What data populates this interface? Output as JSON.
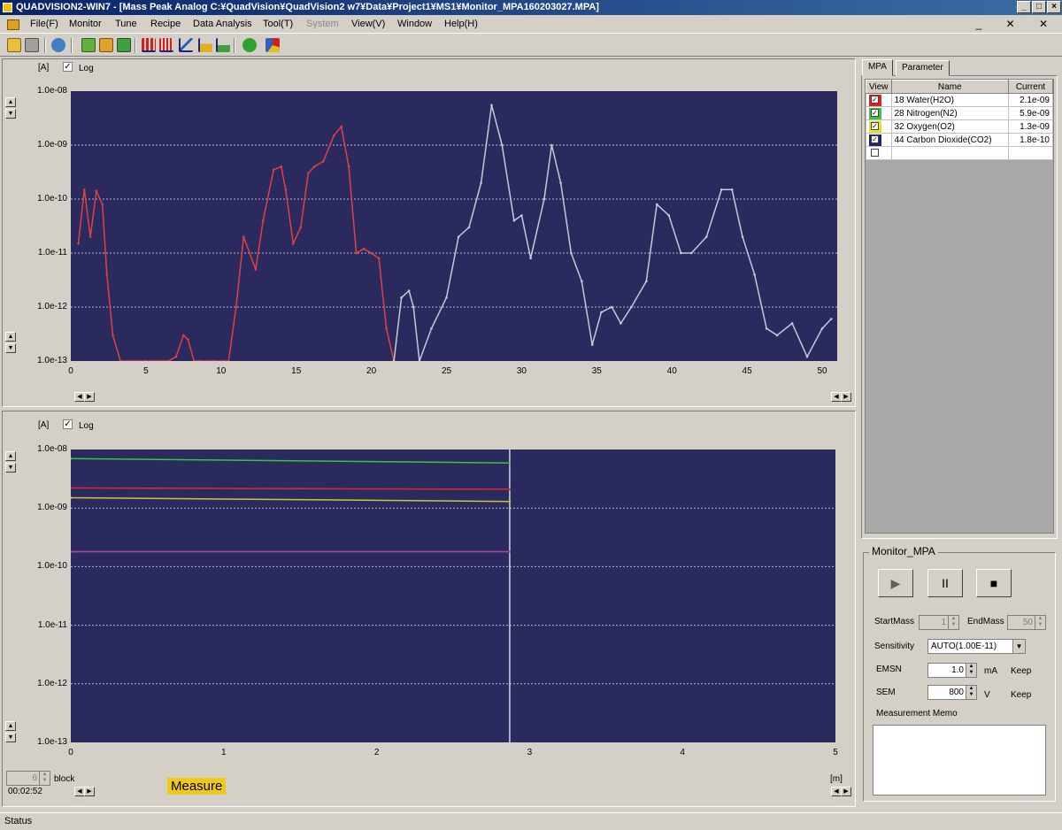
{
  "window": {
    "title": "QUADVISION2-WIN7 - [Mass Peak Analog C:¥QuadVision¥QuadVision2 w7¥Data¥Project1¥MS1¥Monitor_MPA160203027.MPA]",
    "min_btn": "_",
    "max_btn": "□",
    "close_btn": "×"
  },
  "menu": [
    "File(F)",
    "Monitor",
    "Tune",
    "Recipe",
    "Data Analysis",
    "Tool(T)",
    "System",
    "View(V)",
    "Window",
    "Help(H)"
  ],
  "mdi_controls": "_ ✕ ✕",
  "top_plot": {
    "unit_label": "[A]",
    "log_label": "Log",
    "log_checked": "✓",
    "y_ticks": [
      "1.0e-08",
      "1.0e-09",
      "1.0e-10",
      "1.0e-11",
      "1.0e-12",
      "1.0e-13"
    ],
    "x_ticks": [
      "0",
      "5",
      "10",
      "15",
      "20",
      "25",
      "30",
      "35",
      "40",
      "45",
      "50"
    ]
  },
  "bottom_plot": {
    "unit_label": "[A]",
    "log_label": "Log",
    "log_checked": "✓",
    "y_ticks": [
      "1.0e-08",
      "1.0e-09",
      "1.0e-10",
      "1.0e-11",
      "1.0e-12",
      "1.0e-13"
    ],
    "x_ticks": [
      "0",
      "1",
      "2",
      "3",
      "4",
      "5"
    ],
    "x_unit": "[m]",
    "block_value": "6",
    "block_label": "block",
    "elapsed": "00:02:52",
    "measure_label": "Measure"
  },
  "chart_data": [
    {
      "type": "line",
      "title": "",
      "xlabel": "",
      "ylabel": "[A]",
      "log_y": true,
      "xlim": [
        0,
        51
      ],
      "ylim": [
        1e-13,
        1e-08
      ],
      "series": [
        {
          "color": "#e04040",
          "x": [
            0.5,
            0.9,
            1.3,
            1.7,
            2.1,
            2.4,
            2.8,
            3.3,
            5,
            6.5,
            7,
            7.5,
            7.8,
            8.2,
            8.6,
            9.5,
            10.5,
            11,
            11.5,
            12.3,
            12.8,
            13.5,
            14,
            14.3,
            14.8,
            15.3,
            15.8,
            16.2,
            16.8,
            17.5,
            18,
            18.5,
            19,
            19.5,
            20,
            20.5,
            21,
            21.5
          ],
          "y": [
            1.5e-11,
            1.5e-10,
            2e-11,
            1.4e-10,
            8e-11,
            4e-12,
            3e-13,
            1e-13,
            1e-13,
            1e-13,
            1.2e-13,
            3e-13,
            2.5e-13,
            1e-13,
            1e-13,
            1e-13,
            1e-13,
            1e-12,
            2e-11,
            5e-12,
            4e-11,
            3.5e-10,
            4e-10,
            1.5e-10,
            1.5e-11,
            3e-11,
            3e-10,
            4e-10,
            5e-10,
            1.5e-09,
            2.2e-09,
            4e-10,
            1e-11,
            1.2e-11,
            1e-11,
            8e-12,
            4e-13,
            1e-13
          ]
        },
        {
          "color": "#c8c8d8",
          "x": [
            21.5,
            22,
            22.5,
            22.8,
            23.2,
            24,
            25,
            25.8,
            26.5,
            27.3,
            28,
            28.7,
            29.5,
            30,
            30.6,
            31.5,
            32,
            32.6,
            33.3,
            34,
            34.7,
            35.3,
            36,
            36.6,
            37.3,
            38.3,
            39,
            39.8,
            40.6,
            41.3,
            42.3,
            43.3,
            44,
            44.7,
            45.5,
            46.3,
            47,
            48,
            49,
            50,
            50.6
          ],
          "y": [
            1e-13,
            1.5e-12,
            2e-12,
            1e-12,
            1e-13,
            4e-13,
            1.5e-12,
            2e-11,
            3e-11,
            2e-10,
            5.5e-09,
            1e-09,
            4e-11,
            5e-11,
            8e-12,
            1e-10,
            1e-09,
            2e-10,
            1e-11,
            3e-12,
            2e-13,
            8e-13,
            1e-12,
            5e-13,
            1e-12,
            3e-12,
            8e-11,
            5e-11,
            1e-11,
            1e-11,
            2e-11,
            1.5e-10,
            1.5e-10,
            2e-11,
            4e-12,
            4e-13,
            3e-13,
            5e-13,
            1.2e-13,
            4e-13,
            6e-13
          ]
        }
      ]
    },
    {
      "type": "line",
      "title": "",
      "xlabel": "[m]",
      "ylabel": "[A]",
      "log_y": true,
      "xlim": [
        0,
        5
      ],
      "ylim": [
        1e-13,
        1e-08
      ],
      "cursor_x": 2.87,
      "series": [
        {
          "name": "28 Nitrogen(N2)",
          "color": "#40c040",
          "x": [
            0,
            2.87
          ],
          "y": [
            7e-09,
            5.9e-09
          ]
        },
        {
          "name": "18 Water(H2O)",
          "color": "#d03030",
          "x": [
            0,
            2.87
          ],
          "y": [
            2.2e-09,
            2.1e-09
          ]
        },
        {
          "name": "32 Oxygen(O2)",
          "color": "#c8c830",
          "x": [
            0,
            2.87
          ],
          "y": [
            1.5e-09,
            1.3e-09
          ]
        },
        {
          "name": "44 Carbon Dioxide(CO2)",
          "color": "#a050a0",
          "x": [
            0,
            2.87
          ],
          "y": [
            1.8e-10,
            1.8e-10
          ]
        }
      ]
    }
  ],
  "right_panel": {
    "tabs": [
      "MPA",
      "Parameter"
    ],
    "columns": [
      "View",
      "Name",
      "Current"
    ],
    "rows": [
      {
        "color": "#e02020",
        "checked": "✓",
        "name": "18 Water(H2O)",
        "current": "2.1e-09"
      },
      {
        "color": "#40c040",
        "checked": "✓",
        "name": "28 Nitrogen(N2)",
        "current": "5.9e-09"
      },
      {
        "color": "#e8e020",
        "checked": "✓",
        "name": "32 Oxygen(O2)",
        "current": "1.3e-09"
      },
      {
        "color": "#202070",
        "checked": "✓",
        "name": "44 Carbon Dioxide(CO2)",
        "current": "1.8e-10"
      },
      {
        "color": "",
        "checked": "",
        "name": "",
        "current": ""
      }
    ]
  },
  "monitor": {
    "title": "Monitor_MPA",
    "play": "▶",
    "pause": "II",
    "stop": "■",
    "start_mass_label": "StartMass",
    "start_mass": "1",
    "end_mass_label": "EndMass",
    "end_mass": "50",
    "sensitivity_label": "Sensitivity",
    "sensitivity": "AUTO(1.00E-11)",
    "emsn_label": "EMSN",
    "emsn": "1.0",
    "emsn_unit": "mA",
    "emsn_keep": "Keep",
    "sem_label": "SEM",
    "sem": "800",
    "sem_unit": "V",
    "sem_keep": "Keep",
    "memo_label": "Measurement Memo",
    "memo": ""
  },
  "status": "Status"
}
